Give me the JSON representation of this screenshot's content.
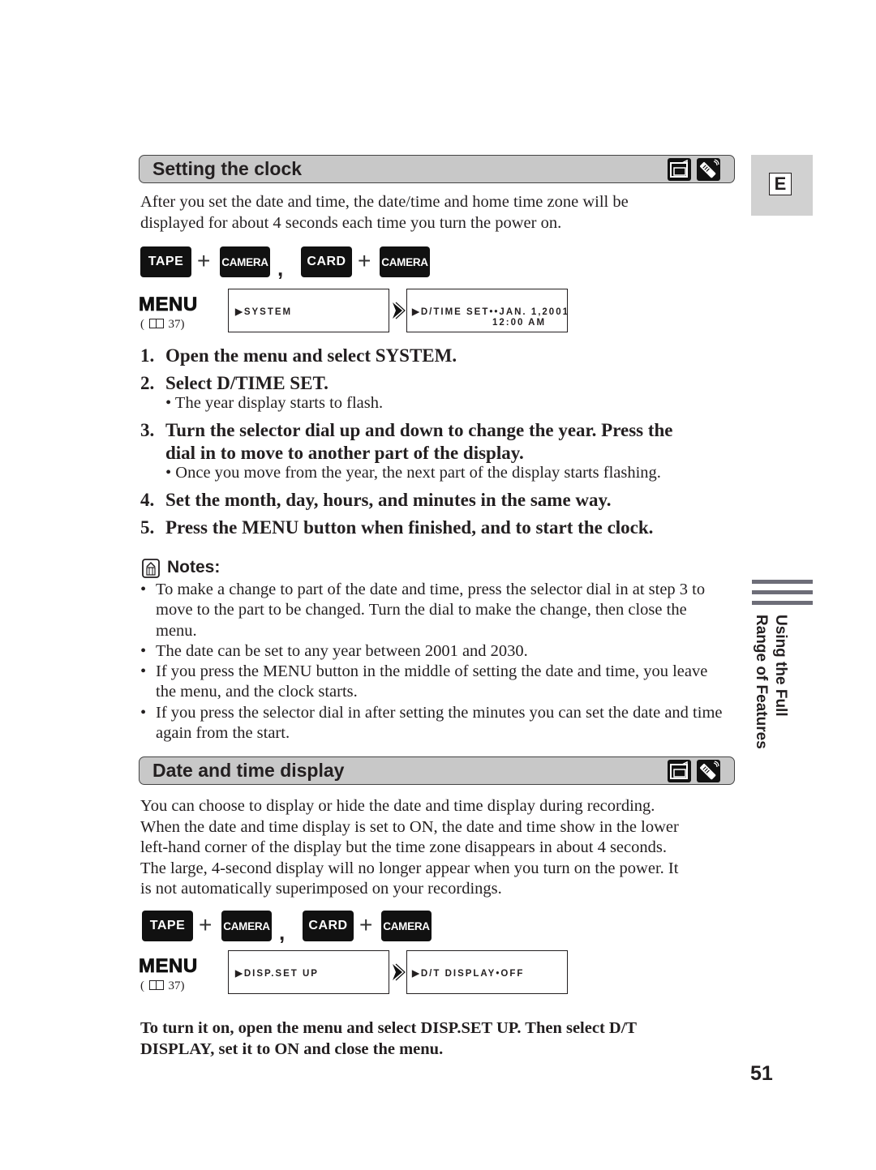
{
  "side_tab": {
    "letter": "E"
  },
  "side_section": {
    "line1": "Using the Full",
    "line2": "Range of Features"
  },
  "page_number": "51",
  "sections": [
    {
      "title": "Setting the clock",
      "icons": [
        "camcorder-icon",
        "remote-control-icon"
      ],
      "intro": [
        "After you set the date and time, the date/time and home time zone will be",
        "displayed for about 4 seconds each time you turn the power on."
      ],
      "modes": {
        "key1": "TAPE",
        "plus": "+",
        "key2": "CAMERA",
        "comma": ",",
        "key3": "CARD",
        "key4": "CAMERA"
      },
      "menu": {
        "label": "MENU",
        "ref_open": "(",
        "ref_page": "37)",
        "screen1": "▶SYSTEM",
        "screen2_line1": "▶D/TIME SET••JAN. 1,2001",
        "screen2_line2": "12:00 AM"
      },
      "steps": [
        {
          "num": "1.",
          "text": "Open the menu and select SYSTEM."
        },
        {
          "num": "2.",
          "text": "Select D/TIME SET.",
          "bullet": "•  The year display starts to flash."
        },
        {
          "num": "3.",
          "text_line1": "Turn the selector dial up and down to change the year. Press the",
          "text_line2": "dial in to move to another part of the display.",
          "bullet": "•  Once you move from the year, the next part of the display starts flashing."
        },
        {
          "num": "4.",
          "text": "Set the month, day, hours, and minutes in the same way."
        },
        {
          "num": "5.",
          "text": "Press the MENU button when finished, and to start the clock."
        }
      ],
      "notes": {
        "title": "Notes:",
        "items": [
          "To make a change to part of the date and time, press the selector dial in at step 3 to move to the part to be changed. Turn the dial to make the change, then close the menu.",
          "The date can be set to any year between 2001 and 2030.",
          "If you press the MENU button in the middle of setting the date and time, you leave the menu, and the clock starts.",
          "If you press the selector dial in after setting the minutes you can set the date and time again from the start."
        ]
      }
    },
    {
      "title": "Date and time display",
      "icons": [
        "camcorder-icon",
        "remote-control-icon"
      ],
      "intro": [
        "You can choose to display or hide the date and time display during recording.",
        "When the date and time display is set to ON, the date and time show in the lower",
        "left-hand corner of the display but the time zone disappears in about 4 seconds.",
        "The large, 4-second display will no longer appear when you turn on the power. It",
        "is not automatically superimposed on your recordings."
      ],
      "modes": {
        "key1": "TAPE",
        "plus": "+",
        "key2": "CAMERA",
        "comma": ",",
        "key3": "CARD",
        "key4": "CAMERA"
      },
      "menu": {
        "label": "MENU",
        "ref_open": "(",
        "ref_page": "37)",
        "screen1": "▶DISP.SET UP",
        "screen2_line1": "▶D/T DISPLAY•OFF"
      },
      "instruction": [
        "To turn it on, open the menu and select DISP.SET UP. Then select D/T",
        "DISPLAY, set it to ON and close the menu."
      ]
    }
  ]
}
